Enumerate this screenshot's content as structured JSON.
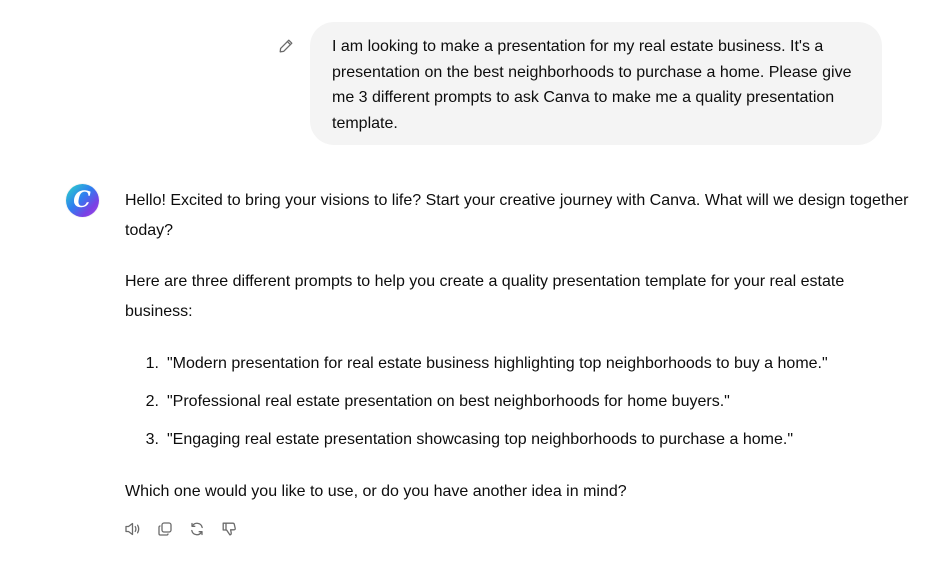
{
  "user_message": {
    "text": "I am looking to make a presentation for my real estate business. It's a presentation on the best neighborhoods to purchase a home. Please give me 3 different prompts to ask Canva to make me a quality presentation template.",
    "edit_icon": "pencil-icon"
  },
  "assistant": {
    "avatar_letter": "C",
    "avatar_colors": [
      "#2bd9c6",
      "#2f7df0",
      "#7b3fe4",
      "#a04de8"
    ],
    "greeting": "Hello! Excited to bring your visions to life? Start your creative journey with Canva. What will we design together today?",
    "intro": "Here are three different prompts to help you create a quality presentation template for your real estate business:",
    "prompts": [
      {
        "number": "1.",
        "text": "\"Modern presentation for real estate business highlighting top neighborhoods to buy a home.\""
      },
      {
        "number": "2.",
        "text": "\"Professional real estate presentation on best neighborhoods for home buyers.\""
      },
      {
        "number": "3.",
        "text": "\"Engaging real estate presentation showcasing top neighborhoods to purchase a home.\""
      }
    ],
    "closing": "Which one would you like to use, or do you have another idea in mind?"
  },
  "actions": [
    {
      "icon": "speaker-icon"
    },
    {
      "icon": "copy-icon"
    },
    {
      "icon": "regenerate-icon"
    },
    {
      "icon": "thumbs-down-icon"
    }
  ]
}
